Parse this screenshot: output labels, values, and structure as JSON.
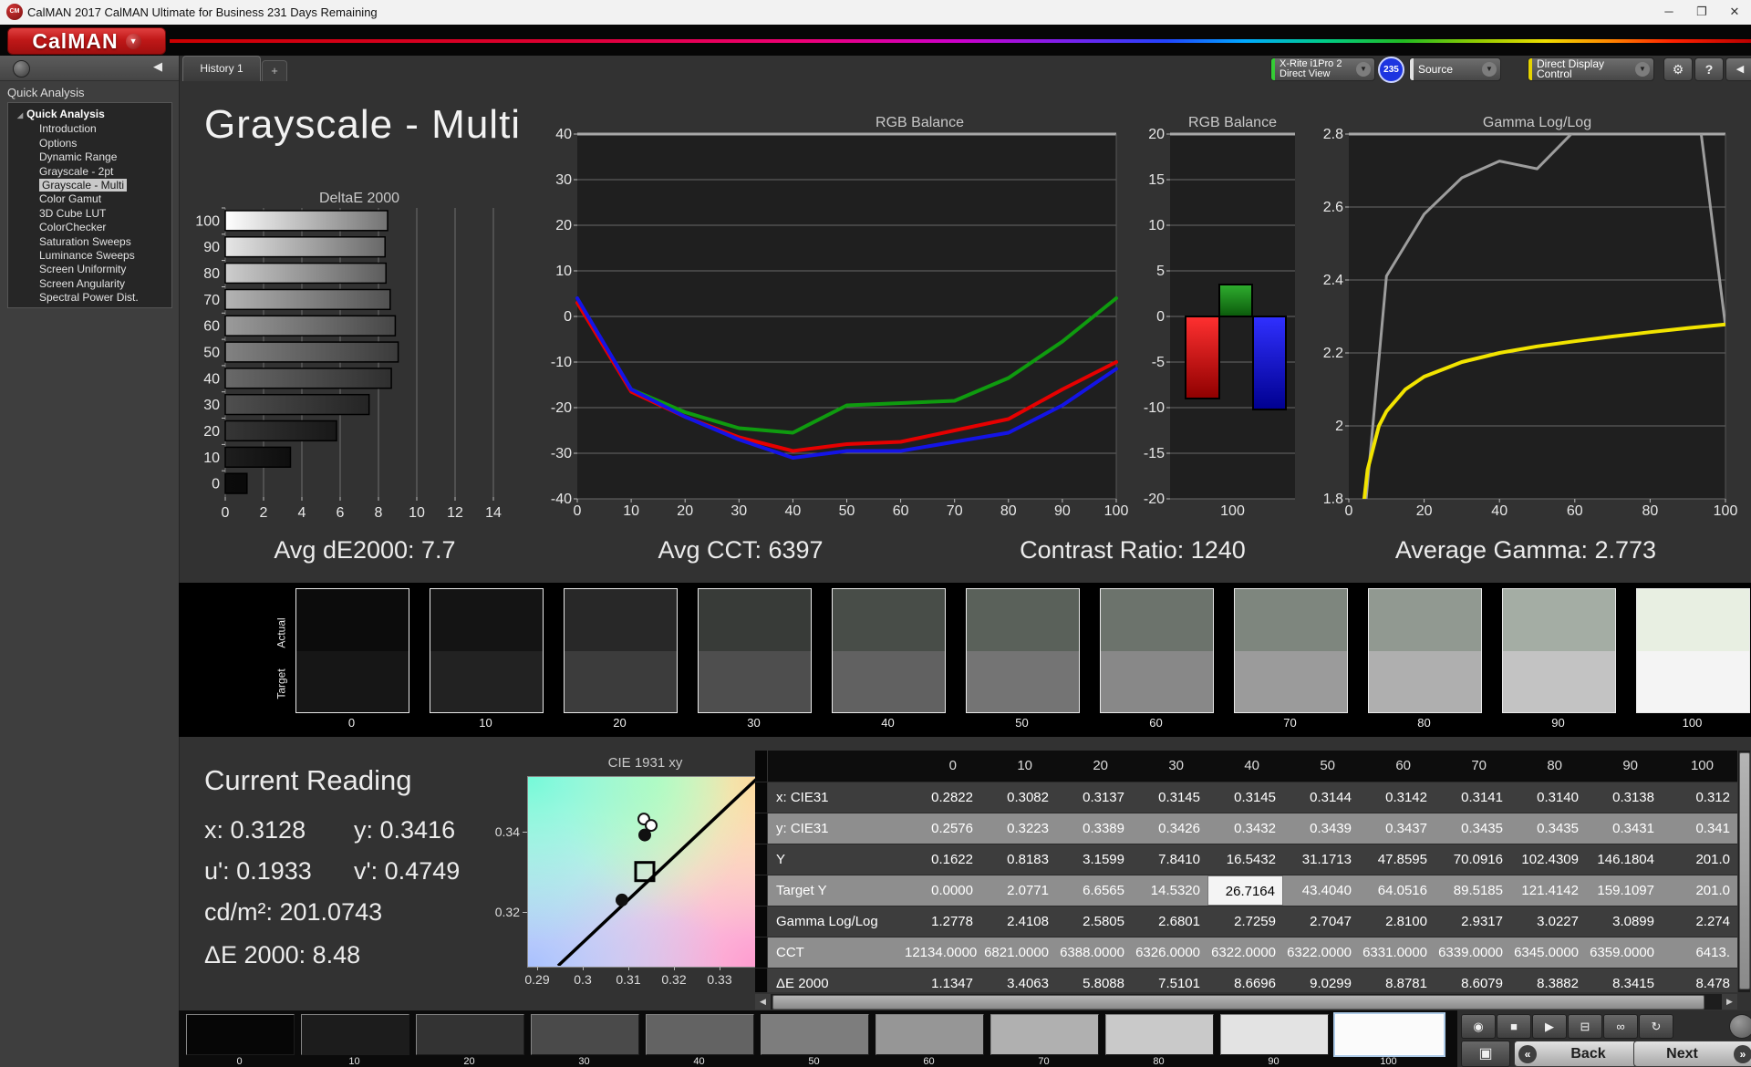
{
  "window": {
    "title": "CalMAN 2017 CalMAN Ultimate for Business 231 Days Remaining",
    "controls": {
      "minimize": "─",
      "maximize": "❐",
      "close": "✕"
    }
  },
  "logo": {
    "text": "CalMAN",
    "arrow": "▼"
  },
  "tabs": {
    "active_label": "History 1",
    "add_label": "+"
  },
  "toolbar": {
    "meter_line1": "X-Rite i1Pro 2",
    "meter_line2": "Direct View",
    "meter_accent": "#35cc35",
    "badge": "235",
    "source_label": "Source",
    "source_accent": "#e0e0e0",
    "display_control_label": "Direct Display Control",
    "display_accent": "#e6d400",
    "gear_icon": "⚙",
    "help_icon": "?",
    "collapse_icon": "◀"
  },
  "sidebar": {
    "header": "Quick Analysis",
    "items": [
      {
        "label": "Quick Analysis",
        "level": 0,
        "bold": true,
        "selected": false
      },
      {
        "label": "Introduction",
        "level": 1,
        "selected": false
      },
      {
        "label": "Options",
        "level": 1,
        "selected": false
      },
      {
        "label": "Dynamic Range",
        "level": 1,
        "selected": false
      },
      {
        "label": "Grayscale - 2pt",
        "level": 1,
        "selected": false
      },
      {
        "label": "Grayscale - Multi",
        "level": 1,
        "selected": true
      },
      {
        "label": "Color Gamut",
        "level": 1,
        "selected": false
      },
      {
        "label": "3D Cube LUT",
        "level": 1,
        "selected": false
      },
      {
        "label": "ColorChecker",
        "level": 1,
        "selected": false
      },
      {
        "label": "Saturation Sweeps",
        "level": 1,
        "selected": false
      },
      {
        "label": "Luminance Sweeps",
        "level": 1,
        "selected": false
      },
      {
        "label": "Screen Uniformity",
        "level": 1,
        "selected": false
      },
      {
        "label": "Screen Angularity",
        "level": 1,
        "selected": false
      },
      {
        "label": "Spectral Power Dist.",
        "level": 1,
        "selected": false
      }
    ]
  },
  "page": {
    "title": "Grayscale - Multi"
  },
  "summary": {
    "avg_de": "Avg dE2000: 7.7",
    "avg_cct": "Avg CCT: 6397",
    "contrast": "Contrast Ratio: 1240",
    "avg_gamma": "Average Gamma: 2.773"
  },
  "current_reading": {
    "title": "Current Reading",
    "x": "x: 0.3128",
    "y": "y: 0.3416",
    "u": "u': 0.1933",
    "v": "v': 0.4749",
    "cd": "cd/m²: 201.0743",
    "de": "ΔE 2000: 8.48"
  },
  "chart_data": [
    {
      "id": "deltae",
      "type": "bar",
      "orientation": "horizontal",
      "title": "DeltaE 2000",
      "categories": [
        100,
        90,
        80,
        70,
        60,
        50,
        40,
        30,
        20,
        10,
        0
      ],
      "values": [
        8.478,
        8.3415,
        8.3882,
        8.6079,
        8.8781,
        9.0299,
        8.6696,
        7.5101,
        5.8088,
        3.4063,
        1.1347
      ],
      "xlim": [
        0,
        14
      ],
      "xticks": [
        0,
        2,
        4,
        6,
        8,
        10,
        12,
        14
      ],
      "bar_colors": [
        "#ffffff",
        "#e6e6e6",
        "#cdcdcd",
        "#b4b4b4",
        "#9b9b9b",
        "#828282",
        "#696969",
        "#4f4f4f",
        "#363636",
        "#1e1e1e",
        "#0b0b0b"
      ]
    },
    {
      "id": "rgb_line",
      "type": "line",
      "title": "RGB Balance",
      "x": [
        0,
        10,
        20,
        30,
        40,
        50,
        60,
        70,
        80,
        90,
        100
      ],
      "ylim": [
        -40,
        40
      ],
      "yticks": [
        40,
        30,
        20,
        10,
        0,
        -10,
        -20,
        -30,
        -40
      ],
      "series": [
        {
          "name": "Green",
          "color": "#0f9b0f",
          "values": [
            3,
            -16,
            -21,
            -24.5,
            -25.5,
            -19.5,
            -19,
            -18.5,
            -13.5,
            -5.5,
            4
          ]
        },
        {
          "name": "Red",
          "color": "#e60000",
          "values": [
            3,
            -16.5,
            -22,
            -26.5,
            -29.5,
            -28,
            -27.5,
            -25,
            -22.5,
            -16,
            -10
          ]
        },
        {
          "name": "Blue",
          "color": "#1414e6",
          "values": [
            4,
            -16,
            -22,
            -27,
            -31,
            -29.5,
            -29.5,
            -27.5,
            -25.5,
            -19.5,
            -11.5
          ]
        }
      ]
    },
    {
      "id": "rgb_bar",
      "type": "bar",
      "title": "RGB Balance",
      "category": "100",
      "ylim": [
        -20,
        20
      ],
      "yticks": [
        20,
        15,
        10,
        5,
        0,
        -5,
        -10,
        -15,
        -20
      ],
      "series": [
        {
          "name": "Red",
          "value": -9.0,
          "color_top": "#ff3030",
          "color_bottom": "#8f0000"
        },
        {
          "name": "Green",
          "value": 3.5,
          "color_top": "#2fae2f",
          "color_bottom": "#0b5a0b"
        },
        {
          "name": "Blue",
          "value": -10.2,
          "color_top": "#3030ff",
          "color_bottom": "#00008f"
        }
      ]
    },
    {
      "id": "gamma",
      "type": "line",
      "title": "Gamma Log/Log",
      "x": [
        0,
        10,
        20,
        30,
        40,
        50,
        60,
        70,
        80,
        90,
        100
      ],
      "measured": [
        1.2778,
        2.4108,
        2.5805,
        2.6801,
        2.7259,
        2.7047,
        2.81,
        2.9317,
        3.0227,
        3.0899,
        2.274
      ],
      "target_curve": [
        [
          3,
          1.7
        ],
        [
          5,
          1.88
        ],
        [
          8,
          2.0
        ],
        [
          10,
          2.04
        ],
        [
          15,
          2.1
        ],
        [
          20,
          2.135
        ],
        [
          25,
          2.155
        ],
        [
          30,
          2.175
        ],
        [
          40,
          2.2
        ],
        [
          50,
          2.218
        ],
        [
          60,
          2.232
        ],
        [
          70,
          2.245
        ],
        [
          80,
          2.257
        ],
        [
          90,
          2.268
        ],
        [
          100,
          2.278
        ]
      ],
      "ylim": [
        1.8,
        2.8
      ],
      "yticks": [
        "2.8",
        "2.6",
        "2.4",
        "2.2",
        "2",
        "1.8"
      ],
      "xticks": [
        0,
        20,
        40,
        60,
        80,
        100
      ],
      "colors": {
        "measured": "#9d9d9d",
        "target": "#f2e400"
      }
    },
    {
      "id": "cie",
      "type": "scatter",
      "title": "CIE 1931 xy",
      "xlim": [
        0.2878,
        0.3388
      ],
      "ylim": [
        0.3066,
        0.3539
      ],
      "xticks": [
        "0.29",
        "0.3",
        "0.31",
        "0.32",
        "0.33"
      ],
      "yticks": [
        "0.34",
        "0.32"
      ],
      "locus_line": [
        [
          0.2946,
          0.3066
        ],
        [
          0.3388,
          0.3539
        ]
      ],
      "points": [
        {
          "x": 0.3134,
          "y": 0.3432,
          "fill": "white"
        },
        {
          "x": 0.315,
          "y": 0.3416,
          "fill": "white"
        },
        {
          "x": 0.3136,
          "y": 0.3392,
          "fill": "black"
        },
        {
          "x": 0.3086,
          "y": 0.323,
          "fill": "black"
        }
      ],
      "target_square": {
        "x": 0.3136,
        "y": 0.3301
      }
    }
  ],
  "swatch_strip": {
    "actual_label": "Actual",
    "target_label": "Target",
    "swatches": [
      {
        "label": "0",
        "actual": "#0c0c0c",
        "target": "#161616"
      },
      {
        "label": "10",
        "actual": "#141414",
        "target": "#222222"
      },
      {
        "label": "20",
        "actual": "#282828",
        "target": "#3c3c3c"
      },
      {
        "label": "30",
        "actual": "#383b38",
        "target": "#4e4e4e"
      },
      {
        "label": "40",
        "actual": "#484d48",
        "target": "#616161"
      },
      {
        "label": "50",
        "actual": "#5a615a",
        "target": "#747474"
      },
      {
        "label": "60",
        "actual": "#6c736c",
        "target": "#888888"
      },
      {
        "label": "70",
        "actual": "#7e867e",
        "target": "#9b9b9b"
      },
      {
        "label": "80",
        "actual": "#919991",
        "target": "#afafaf"
      },
      {
        "label": "90",
        "actual": "#a4ada4",
        "target": "#c3c3c3"
      },
      {
        "label": "100",
        "actual": "#e8efe2",
        "target": "#f4f4f4"
      }
    ]
  },
  "table": {
    "headers": [
      "0",
      "10",
      "20",
      "30",
      "40",
      "50",
      "60",
      "70",
      "80",
      "90",
      "100"
    ],
    "rows": [
      {
        "label": "x: CIE31",
        "values": [
          "0.2822",
          "0.3082",
          "0.3137",
          "0.3145",
          "0.3145",
          "0.3144",
          "0.3142",
          "0.3141",
          "0.3140",
          "0.3138",
          "0.312"
        ]
      },
      {
        "label": "y: CIE31",
        "values": [
          "0.2576",
          "0.3223",
          "0.3389",
          "0.3426",
          "0.3432",
          "0.3439",
          "0.3437",
          "0.3435",
          "0.3435",
          "0.3431",
          "0.341"
        ]
      },
      {
        "label": "Y",
        "values": [
          "0.1622",
          "0.8183",
          "3.1599",
          "7.8410",
          "16.5432",
          "31.1713",
          "47.8595",
          "70.0916",
          "102.4309",
          "146.1804",
          "201.0"
        ]
      },
      {
        "label": "Target Y",
        "values": [
          "0.0000",
          "2.0771",
          "6.6565",
          "14.5320",
          "26.7164",
          "43.4040",
          "64.0516",
          "89.5185",
          "121.4142",
          "159.1097",
          "201.0"
        ]
      },
      {
        "label": "Gamma Log/Log",
        "values": [
          "1.2778",
          "2.4108",
          "2.5805",
          "2.6801",
          "2.7259",
          "2.7047",
          "2.8100",
          "2.9317",
          "3.0227",
          "3.0899",
          "2.274"
        ]
      },
      {
        "label": "CCT",
        "values": [
          "12134.0000",
          "6821.0000",
          "6388.0000",
          "6326.0000",
          "6322.0000",
          "6322.0000",
          "6331.0000",
          "6339.0000",
          "6345.0000",
          "6359.0000",
          "6413."
        ]
      },
      {
        "label": "ΔE 2000",
        "values": [
          "1.1347",
          "3.4063",
          "5.8088",
          "7.5101",
          "8.6696",
          "9.0299",
          "8.8781",
          "8.6079",
          "8.3882",
          "8.3415",
          "8.478"
        ]
      }
    ],
    "highlight": {
      "row": 3,
      "col": 4
    }
  },
  "patch_bar": {
    "patches": [
      {
        "label": "0",
        "color": "#060606",
        "selected": false
      },
      {
        "label": "10",
        "color": "#1c1c1c",
        "selected": false
      },
      {
        "label": "20",
        "color": "#333333",
        "selected": false
      },
      {
        "label": "30",
        "color": "#4a4a4a",
        "selected": false
      },
      {
        "label": "40",
        "color": "#636363",
        "selected": false
      },
      {
        "label": "50",
        "color": "#7d7d7d",
        "selected": false
      },
      {
        "label": "60",
        "color": "#969696",
        "selected": false
      },
      {
        "label": "70",
        "color": "#b0b0b0",
        "selected": false
      },
      {
        "label": "80",
        "color": "#c9c9c9",
        "selected": false
      },
      {
        "label": "90",
        "color": "#e3e3e3",
        "selected": false
      },
      {
        "label": "100",
        "color": "#fbfbfb",
        "selected": true
      }
    ]
  },
  "transport": {
    "small_buttons": [
      {
        "name": "meter-eye-button",
        "glyph": "◉"
      },
      {
        "name": "stop-button",
        "glyph": "■"
      },
      {
        "name": "play-button",
        "glyph": "▶"
      },
      {
        "name": "pattern-window-button",
        "glyph": "⊟"
      },
      {
        "name": "continuous-read-button",
        "glyph": "∞"
      },
      {
        "name": "refresh-button",
        "glyph": "↻"
      }
    ],
    "big_button_glyph": "▣",
    "back_icon": "«",
    "back_label": "Back",
    "next_label": "Next",
    "next_icon": "»"
  }
}
